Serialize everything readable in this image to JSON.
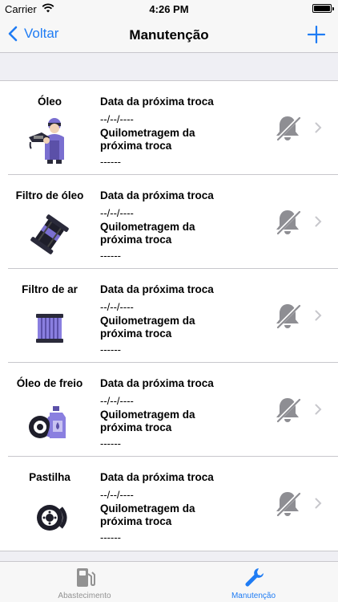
{
  "status_bar": {
    "carrier": "Carrier",
    "time": "4:26 PM"
  },
  "nav": {
    "back_label": "Voltar",
    "title": "Manutenção"
  },
  "accent_color": "#1f7cf4",
  "items": [
    {
      "name": "Óleo",
      "icon": "oil-change-mechanic-icon",
      "date_label": "Data da próxima troca",
      "date_value": "--/--/----",
      "km_label": "Quilometragem da próxima troca",
      "km_value": "------"
    },
    {
      "name": "Filtro de óleo",
      "icon": "oil-filter-icon",
      "date_label": "Data da próxima troca",
      "date_value": "--/--/----",
      "km_label": "Quilometragem da próxima troca",
      "km_value": "------"
    },
    {
      "name": "Filtro de ar",
      "icon": "air-filter-icon",
      "date_label": "Data da próxima troca",
      "date_value": "--/--/----",
      "km_label": "Quilometragem da próxima troca",
      "km_value": "------"
    },
    {
      "name": "Óleo de freio",
      "icon": "brake-fluid-icon",
      "date_label": "Data da próxima troca",
      "date_value": "--/--/----",
      "km_label": "Quilometragem da próxima troca",
      "km_value": "------"
    },
    {
      "name": "Pastilha",
      "icon": "brake-pad-icon",
      "date_label": "Data da próxima troca",
      "date_value": "--/--/----",
      "km_label": "Quilometragem da próxima troca",
      "km_value": "------"
    }
  ],
  "tabs": [
    {
      "label": "Abastecimento",
      "icon": "fuel-pump-icon",
      "active": false
    },
    {
      "label": "Manutenção",
      "icon": "wrench-icon",
      "active": true
    }
  ]
}
